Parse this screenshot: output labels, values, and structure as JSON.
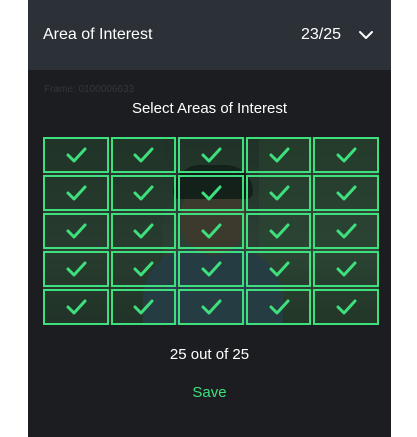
{
  "header": {
    "title": "Area of Interest",
    "count": "23/25"
  },
  "frame_label": "Frame: 0100006633",
  "section_title": "Select Areas of Interest",
  "grid": {
    "rows": 5,
    "columns": 5,
    "selected_count": 25,
    "total": 25
  },
  "selection_summary": "25 out of 25",
  "save_label": "Save",
  "colors": {
    "panel_background": "#1b1d20",
    "header_background": "#2c3137",
    "accent_green": "#3ee07d",
    "text": "#ffffff"
  },
  "icons": {
    "cell_icon": "check-icon",
    "header_toggle": "chevron-down-icon"
  }
}
